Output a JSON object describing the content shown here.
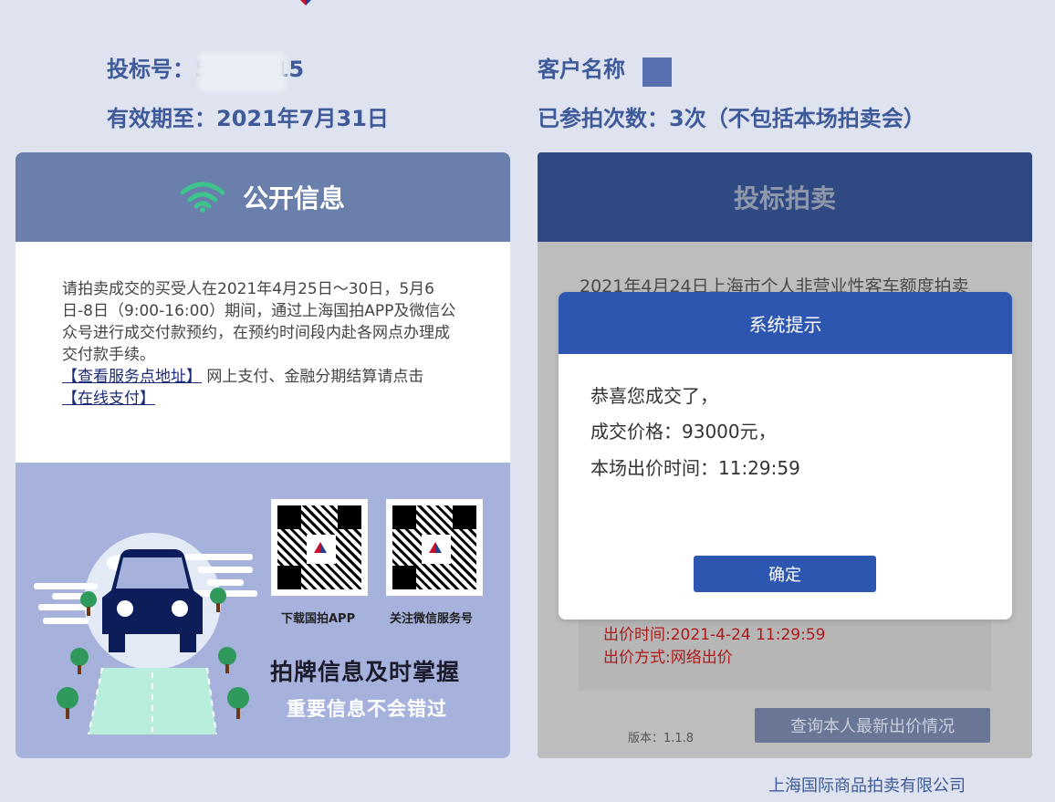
{
  "header": {
    "title_cut": ""
  },
  "info": {
    "bid_no_label": "投标号：",
    "bid_no_prefix": "5",
    "bid_no_suffix": "15",
    "valid_until": "有效期至：2021年7月31日",
    "customer_label": "客户名称",
    "customer_value": "",
    "participation": "已参拍次数：3次（不包括本场拍卖会）"
  },
  "left_card": {
    "title": "公开信息",
    "notice_text": "请拍卖成交的买受人在2021年4月25日～30日，5月6日-8日（9:00-16:00）期间，通过上海国拍APP及微信公众号进行成交付款预约，在预约时间段内赴各网点办理成交付款手续。",
    "link_service": "【查看服务点地址】",
    "link_middle_text": " 网上支付、金融分期结算请点击",
    "link_pay": "【在线支付】",
    "qr1_caption": "下载国拍APP",
    "qr2_caption": "关注微信服务号",
    "promo_title": "拍牌信息及时掌握",
    "promo_subtitle": "重要信息不会错过"
  },
  "right_card": {
    "title": "投标拍卖",
    "bg_title": "2021年4月24日上海市个人非营业性客车额度拍卖",
    "bid_time": "出价时间:2021-4-24 11:29:59",
    "bid_method": "出价方式:网络出价",
    "version": "版本：1.1.8",
    "query_button": "查询本人最新出价情况"
  },
  "modal": {
    "title": "系统提示",
    "line1": "恭喜您成交了，",
    "line2": "成交价格：93000元，",
    "line3": "本场出价时间：11:29:59",
    "ok_button": "确定"
  },
  "footer": {
    "company": "上海国际商品拍卖有限公司"
  },
  "colors": {
    "page_bg": "#dfe3ef",
    "accent_blue": "#2d56b0",
    "label_blue": "#3e5a9a",
    "wifi_green": "#3cc48c",
    "alert_red": "#b01818"
  }
}
